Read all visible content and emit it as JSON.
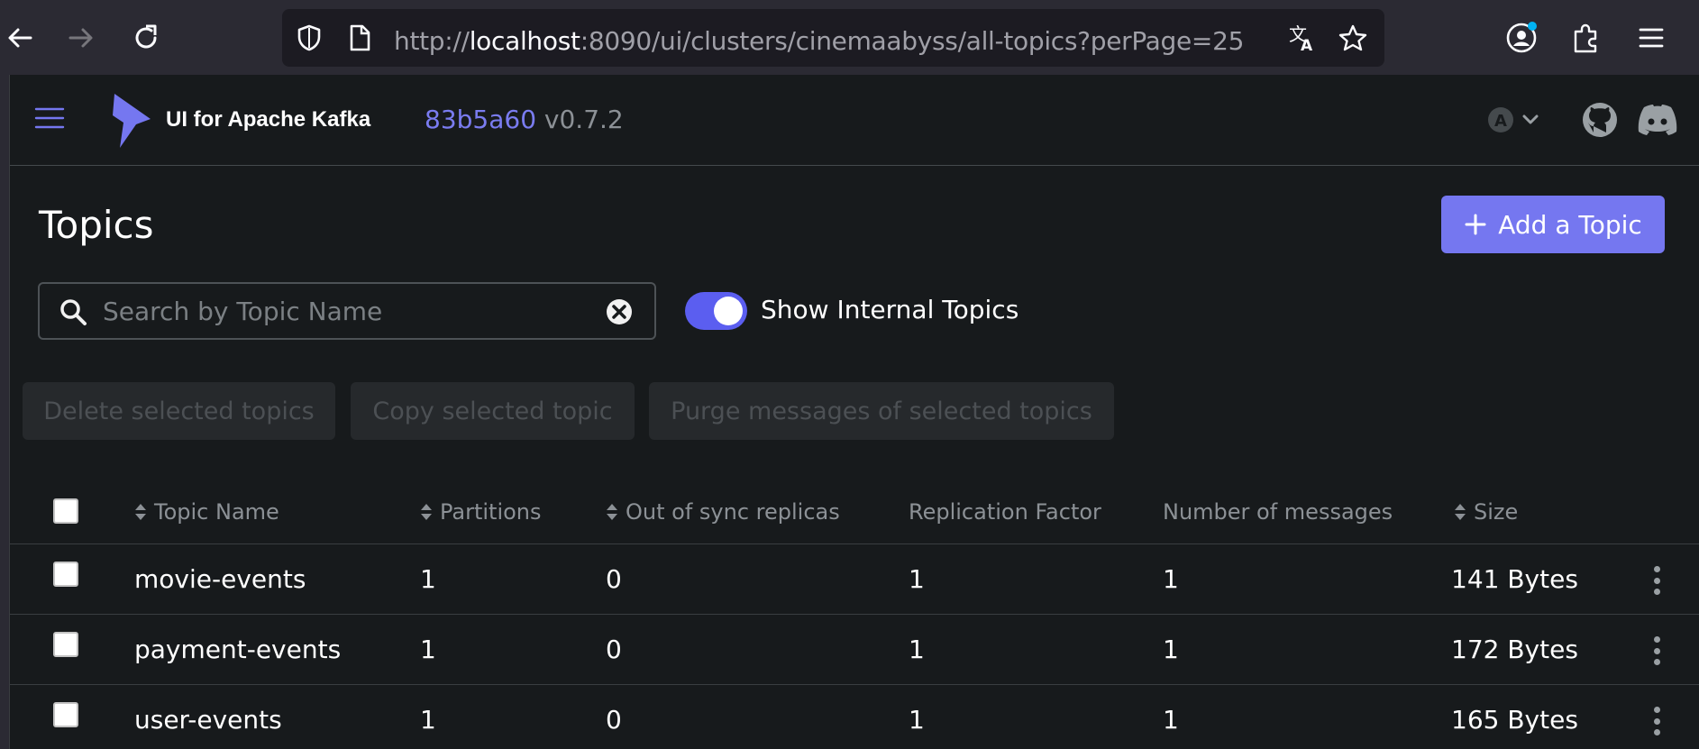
{
  "browser": {
    "url_prefix": "http://",
    "url_host": "localhost",
    "url_rest": ":8090/ui/clusters/cinemaabyss/all-topics?perPage=25"
  },
  "header": {
    "app_name": "UI for Apache Kafka",
    "commit": "83b5a60",
    "version": "v0.7.2",
    "avatar_letter": "A"
  },
  "page": {
    "title": "Topics",
    "add_button": "Add a Topic",
    "search_placeholder": "Search by Topic Name",
    "search_value": "",
    "toggle_label": "Show Internal Topics",
    "toggle_on": true
  },
  "actions": {
    "delete": "Delete selected topics",
    "copy": "Copy selected topic",
    "purge": "Purge messages of selected topics"
  },
  "table": {
    "columns": [
      "Topic Name",
      "Partitions",
      "Out of sync replicas",
      "Replication Factor",
      "Number of messages",
      "Size"
    ],
    "rows": [
      {
        "name": "movie-events",
        "partitions": "1",
        "out_of_sync": "0",
        "replication": "1",
        "messages": "1",
        "size": "141 Bytes"
      },
      {
        "name": "payment-events",
        "partitions": "1",
        "out_of_sync": "0",
        "replication": "1",
        "messages": "1",
        "size": "172 Bytes"
      },
      {
        "name": "user-events",
        "partitions": "1",
        "out_of_sync": "0",
        "replication": "1",
        "messages": "1",
        "size": "165 Bytes"
      }
    ]
  }
}
